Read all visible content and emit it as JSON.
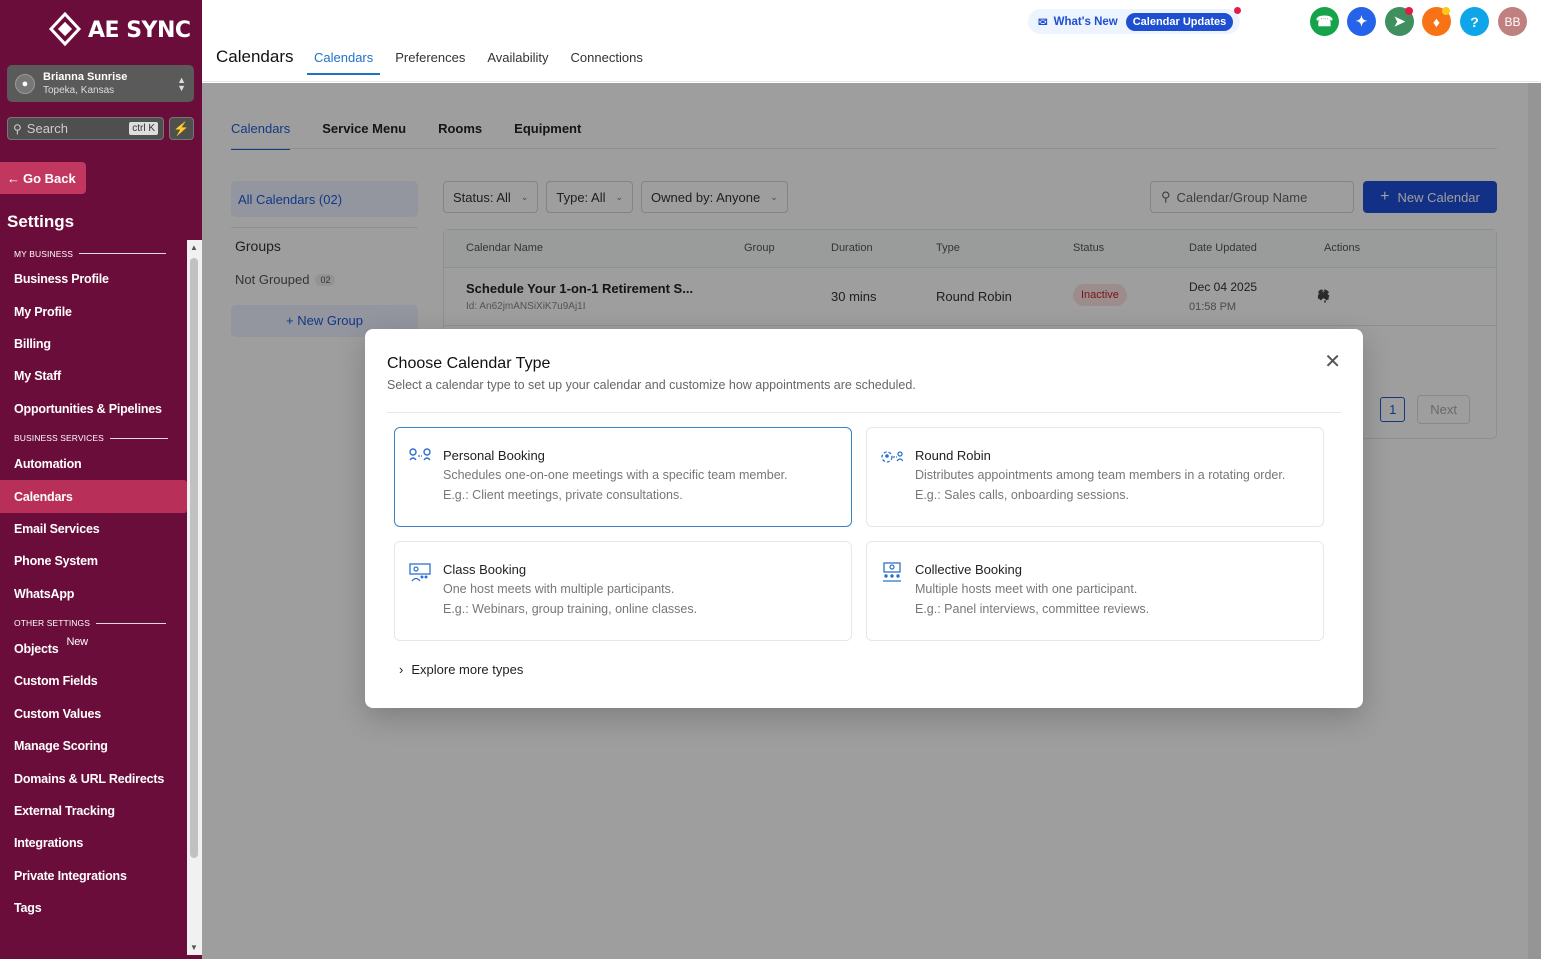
{
  "brand": {
    "name": "AE SYNC"
  },
  "account": {
    "name": "Brianna Sunrise",
    "location": "Topeka, Kansas"
  },
  "sidebar": {
    "search_placeholder": "Search",
    "search_shortcut": "ctrl K",
    "go_back": "Go Back",
    "title": "Settings",
    "sections": [
      {
        "label": "MY BUSINESS",
        "items": [
          "Business Profile",
          "My Profile",
          "Billing",
          "My Staff",
          "Opportunities & Pipelines"
        ]
      },
      {
        "label": "BUSINESS SERVICES",
        "items": [
          "Automation",
          "Calendars",
          "Email Services",
          "Phone System",
          "WhatsApp"
        ]
      },
      {
        "label": "OTHER SETTINGS",
        "items": [
          "Objects",
          "Custom Fields",
          "Custom Values",
          "Manage Scoring",
          "Domains & URL Redirects",
          "External Tracking",
          "Integrations",
          "Private Integrations",
          "Tags"
        ]
      }
    ],
    "active_item": "Calendars",
    "objects_badge": "New"
  },
  "header": {
    "page_title": "Calendars",
    "tabs": [
      "Calendars",
      "Preferences",
      "Availability",
      "Connections"
    ],
    "active_tab": "Calendars",
    "whats_new": "What's New",
    "calendar_updates": "Calendar Updates",
    "avatar_initials": "BB",
    "help": "?"
  },
  "subtabs": {
    "items": [
      "Calendars",
      "Service Menu",
      "Rooms",
      "Equipment"
    ],
    "active": "Calendars"
  },
  "groups": {
    "all_calendars": "All Calendars (02)",
    "heading": "Groups",
    "not_grouped": "Not Grouped",
    "not_grouped_count": "02",
    "new_group": "New Group"
  },
  "filters": {
    "status": "Status: All",
    "type": "Type: All",
    "owned_by": "Owned by: Anyone",
    "search_placeholder": "Calendar/Group Name",
    "new_calendar": "New Calendar"
  },
  "table": {
    "columns": [
      "Calendar Name",
      "Group",
      "Duration",
      "Type",
      "Status",
      "Date Updated",
      "Actions"
    ],
    "rows": [
      {
        "name": "Schedule Your 1-on-1 Retirement S...",
        "id": "Id: An62jmANSiXiK7u9Aj1I",
        "duration": "30 mins",
        "type": "Round Robin",
        "status": "Inactive",
        "date": "Dec 04 2025",
        "time": "01:58 PM"
      }
    ],
    "page": "1",
    "next": "Next"
  },
  "modal": {
    "title": "Choose Calendar Type",
    "subtitle": "Select a calendar type to set up your calendar and customize how appointments are scheduled.",
    "types": [
      {
        "title": "Personal Booking",
        "desc": "Schedules one-on-one meetings with a specific team member.",
        "example": "E.g.: Client meetings, private consultations.",
        "icon": "personal-booking-icon"
      },
      {
        "title": "Round Robin",
        "desc": "Distributes appointments among team members in a rotating order.",
        "example": "E.g.: Sales calls, onboarding sessions.",
        "icon": "round-robin-icon"
      },
      {
        "title": "Class Booking",
        "desc": "One host meets with multiple participants.",
        "example": "E.g.: Webinars, group training, online classes.",
        "icon": "class-booking-icon"
      },
      {
        "title": "Collective Booking",
        "desc": "Multiple hosts meet with one participant.",
        "example": "E.g.: Panel interviews, committee reviews.",
        "icon": "collective-booking-icon"
      }
    ],
    "selected": "Personal Booking",
    "explore": "Explore more types"
  },
  "colors": {
    "sidebar": "#6b0d3a",
    "active_nav": "#b83059",
    "primary": "#1d4ed8",
    "accent": "#1d73c9"
  }
}
